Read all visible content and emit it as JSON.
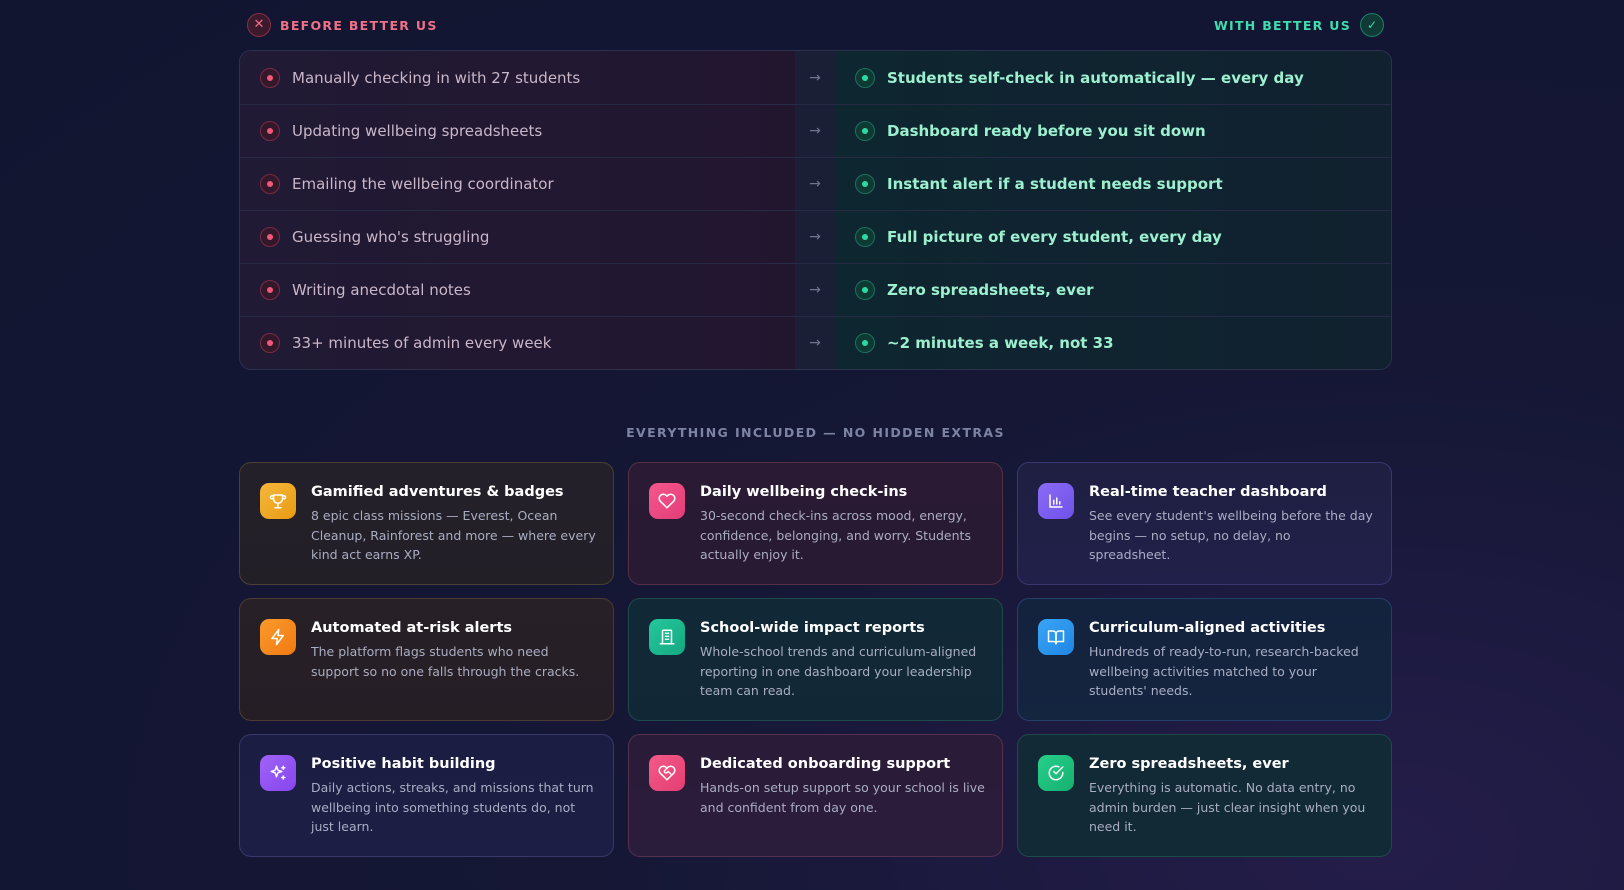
{
  "comparison": {
    "before_label": "BEFORE BETTER US",
    "after_label": "WITH BETTER US",
    "before_icon": "x-icon",
    "after_icon": "check-icon",
    "rows": [
      {
        "before": "Manually checking in with 27 students",
        "after": "Students self-check in automatically — every day"
      },
      {
        "before": "Updating wellbeing spreadsheets",
        "after": "Dashboard ready before you sit down"
      },
      {
        "before": "Emailing the wellbeing coordinator",
        "after": "Instant alert if a student needs support"
      },
      {
        "before": "Guessing who's struggling",
        "after": "Full picture of every student, every day"
      },
      {
        "before": "Writing anecdotal notes",
        "after": "Zero spreadsheets, ever"
      },
      {
        "before": "33+ minutes of admin every week",
        "after": "~2 minutes a week, not 33"
      }
    ]
  },
  "features": {
    "heading": "EVERYTHING INCLUDED — NO HIDDEN EXTRAS",
    "cards": [
      {
        "title": "Gamified adventures & badges",
        "desc": "8 epic class missions — Everest, Ocean Cleanup, Rainforest and more — where every kind act earns XP.",
        "icon": "trophy-icon",
        "color": "#f6b73c"
      },
      {
        "title": "Daily wellbeing check-ins",
        "desc": "30-second check-ins across mood, energy, confidence, belonging, and worry. Students actually enjoy it.",
        "icon": "heart-icon",
        "color": "#f5578b"
      },
      {
        "title": "Real-time teacher dashboard",
        "desc": "See every student's wellbeing before the day begins — no setup, no delay, no spreadsheet.",
        "icon": "bar-chart-icon",
        "color": "#8b6cf6"
      },
      {
        "title": "Automated at-risk alerts",
        "desc": "The platform flags students who need support so no one falls through the cracks.",
        "icon": "lightning-icon",
        "color": "#fb9a2c"
      },
      {
        "title": "School-wide impact reports",
        "desc": "Whole-school trends and curriculum-aligned reporting in one dashboard your leadership team can read.",
        "icon": "building-icon",
        "color": "#25c89a"
      },
      {
        "title": "Curriculum-aligned activities",
        "desc": "Hundreds of ready-to-run, research-backed wellbeing activities matched to your students' needs.",
        "icon": "book-icon",
        "color": "#3aa5f6"
      },
      {
        "title": "Positive habit building",
        "desc": "Daily actions, streaks, and missions that turn wellbeing into something students do, not just learn.",
        "icon": "sparkles-icon",
        "color": "#a063f7"
      },
      {
        "title": "Dedicated onboarding support",
        "desc": "Hands-on setup support so your school is live and confident from day one.",
        "icon": "heart-handshake-icon",
        "color": "#f45a88"
      },
      {
        "title": "Zero spreadsheets, ever",
        "desc": "Everything is automatic. No data entry, no admin burden — just clear insight when you need it.",
        "icon": "check-circle-icon",
        "color": "#27cf8a"
      }
    ]
  }
}
